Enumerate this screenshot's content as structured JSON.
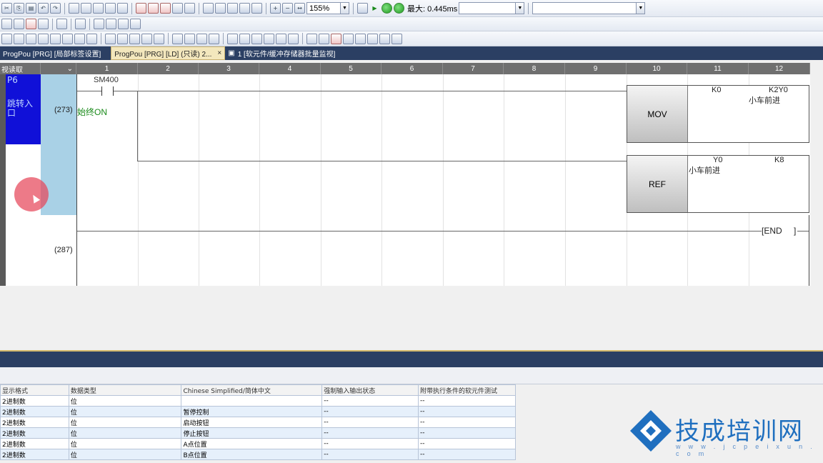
{
  "toolbar": {
    "zoom_value": "155%",
    "scan_label": "最大: 0.445ms",
    "empty_combo": ""
  },
  "tabs": [
    {
      "label": "ProgPou [PRG] [局部标签设置]"
    },
    {
      "label": "ProgPou [PRG] [LD] (只读) 2..."
    },
    {
      "label": "1 [软元件/缓冲存储器批量监视]"
    }
  ],
  "tab_close": "×",
  "ladder": {
    "corner_label": "视读取",
    "corner_dropdown": "⌄",
    "columns": [
      "1",
      "2",
      "3",
      "4",
      "5",
      "6",
      "7",
      "8",
      "9",
      "10",
      "11",
      "12"
    ],
    "pointer": "P6",
    "pointer_comment": "跳转入口",
    "steps": [
      "(273)",
      "(287)"
    ],
    "contact_device": "SM400",
    "contact_comment": "始终ON",
    "instr1": {
      "op": "MOV",
      "arg1": "K0",
      "arg2": "K2Y0",
      "arg2_comment": "小车前进"
    },
    "instr2": {
      "op": "REF",
      "arg1": "Y0",
      "arg1_comment": "小车前进",
      "arg2": "K8"
    },
    "end_label": "[END",
    "end_bracket": "]"
  },
  "grid": {
    "headers": [
      "显示格式",
      "数据类型",
      "Chinese Simplified/简体中文",
      "强制输入输出状态",
      "附带执行条件的软元件测试"
    ],
    "rows": [
      [
        "2进制数",
        "位",
        "",
        "--",
        "--"
      ],
      [
        "2进制数",
        "位",
        "暂停控制",
        "--",
        "--"
      ],
      [
        "2进制数",
        "位",
        "启动按钮",
        "--",
        "--"
      ],
      [
        "2进制数",
        "位",
        "停止按钮",
        "--",
        "--"
      ],
      [
        "2进制数",
        "位",
        "A点位置",
        "--",
        "--"
      ],
      [
        "2进制数",
        "位",
        "B点位置",
        "--",
        "--"
      ]
    ]
  },
  "watermark": {
    "title": "技成培训网",
    "url": "w w w . j c p e i x u n . c o m",
    "color": "#1f6fbf"
  }
}
